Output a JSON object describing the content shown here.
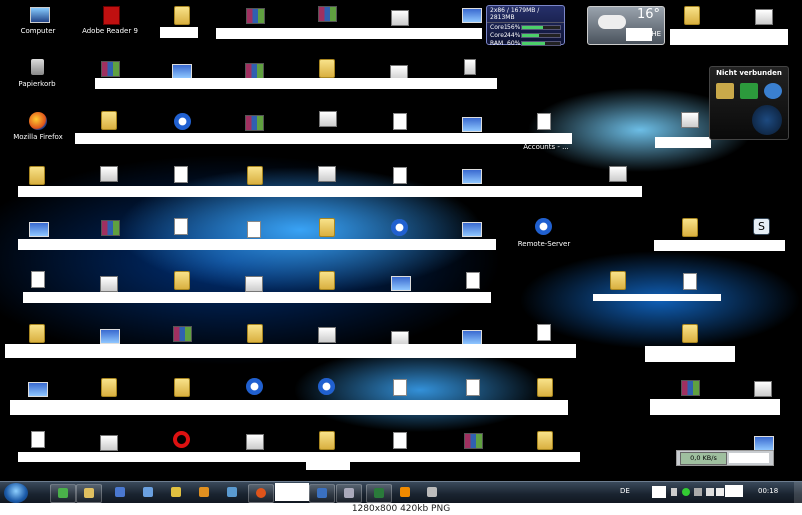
{
  "desktop": {
    "icons": [
      {
        "label": "Computer",
        "kind": "comp"
      },
      {
        "label": "Adobe Reader 9",
        "kind": "pdf"
      },
      {
        "label": "Papierkorb",
        "kind": "bin"
      },
      {
        "label": "Mozilla Firefox",
        "kind": "ff"
      },
      {
        "label": "Accounts - ...",
        "kind": "doc"
      },
      {
        "label": "Remote-Server",
        "kind": "sh"
      }
    ]
  },
  "cpu_gadget": {
    "header": "2x86 / 1679MB / 2813MB",
    "rows": [
      {
        "label": "Core1",
        "pct": "56%",
        "level": 0.56
      },
      {
        "label": "Core2",
        "pct": "44%",
        "level": 0.44
      },
      {
        "label": "RAM",
        "pct": "60%",
        "level": 0.6
      }
    ]
  },
  "weather_gadget": {
    "temp": "16°",
    "city": "HE"
  },
  "skype_gadget": {
    "title": "Nicht verbunden"
  },
  "net_gadget": {
    "speed": "0,0 KB/s"
  },
  "taskbar": {
    "language": "DE",
    "clock": "00:18"
  },
  "footer": {
    "text": "1280x800  420kb  PNG"
  }
}
